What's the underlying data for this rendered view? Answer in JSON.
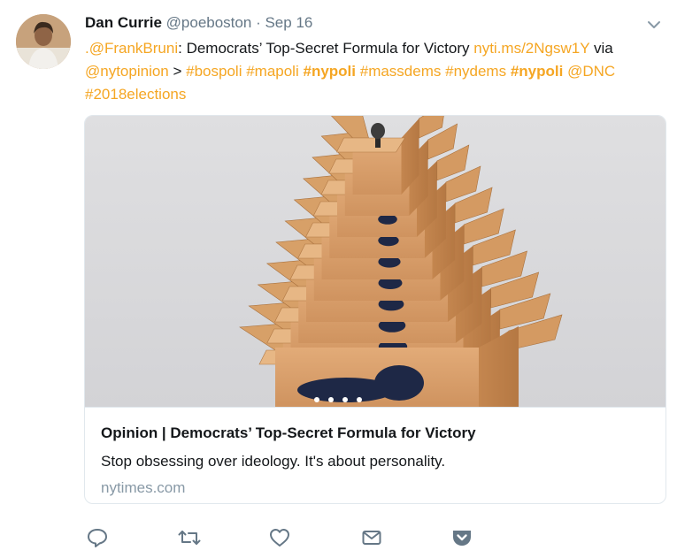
{
  "tweet": {
    "author_name": "Dan Currie",
    "handle": "@poeboston",
    "separator": "·",
    "date": "Sep 16",
    "text_parts": {
      "mention1": ".@FrankBruni",
      "t1": ": Democrats’ Top-Secret Formula for Victory ",
      "link": "nyti.ms/2Ngsw1Y",
      "t2": " via ",
      "mention2": "@nytopinion",
      "t3": " > ",
      "tag1": "#bospoli",
      "tag2": "#mapoli",
      "tag3": "#nypoli",
      "tag4": "#massdems",
      "tag5": "#nydems",
      "tag6": "#nypoli",
      "mention3": "@DNC",
      "tag7": "#2018elections"
    }
  },
  "card": {
    "title": "Opinion | Democrats’ Top-Secret Formula for Victory",
    "description": "Stop obsessing over ideology. It's about personality.",
    "domain": "nytimes.com"
  },
  "actions": [
    {
      "icon": "reply-icon"
    },
    {
      "icon": "retweet-icon"
    },
    {
      "icon": "like-icon"
    },
    {
      "icon": "direct-message-icon"
    },
    {
      "icon": "pocket-icon"
    }
  ],
  "colors": {
    "link": "#f5a623",
    "muted": "#657786",
    "domain": "#8899a6",
    "cardboard": "#d9a06e",
    "donkey": "#1e2846"
  }
}
